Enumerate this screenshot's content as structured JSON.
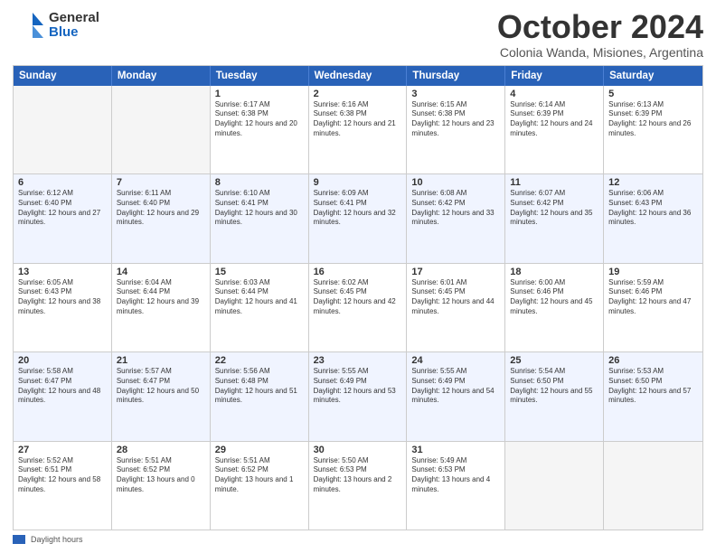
{
  "header": {
    "logo_line1": "General",
    "logo_line2": "Blue",
    "month": "October 2024",
    "location": "Colonia Wanda, Misiones, Argentina"
  },
  "days_of_week": [
    "Sunday",
    "Monday",
    "Tuesday",
    "Wednesday",
    "Thursday",
    "Friday",
    "Saturday"
  ],
  "legend": {
    "label": "Daylight hours"
  },
  "weeks": [
    [
      {
        "day": "",
        "empty": true
      },
      {
        "day": "",
        "empty": true
      },
      {
        "day": "1",
        "sunrise": "Sunrise: 6:17 AM",
        "sunset": "Sunset: 6:38 PM",
        "daylight": "Daylight: 12 hours and 20 minutes."
      },
      {
        "day": "2",
        "sunrise": "Sunrise: 6:16 AM",
        "sunset": "Sunset: 6:38 PM",
        "daylight": "Daylight: 12 hours and 21 minutes."
      },
      {
        "day": "3",
        "sunrise": "Sunrise: 6:15 AM",
        "sunset": "Sunset: 6:38 PM",
        "daylight": "Daylight: 12 hours and 23 minutes."
      },
      {
        "day": "4",
        "sunrise": "Sunrise: 6:14 AM",
        "sunset": "Sunset: 6:39 PM",
        "daylight": "Daylight: 12 hours and 24 minutes."
      },
      {
        "day": "5",
        "sunrise": "Sunrise: 6:13 AM",
        "sunset": "Sunset: 6:39 PM",
        "daylight": "Daylight: 12 hours and 26 minutes."
      }
    ],
    [
      {
        "day": "6",
        "sunrise": "Sunrise: 6:12 AM",
        "sunset": "Sunset: 6:40 PM",
        "daylight": "Daylight: 12 hours and 27 minutes."
      },
      {
        "day": "7",
        "sunrise": "Sunrise: 6:11 AM",
        "sunset": "Sunset: 6:40 PM",
        "daylight": "Daylight: 12 hours and 29 minutes."
      },
      {
        "day": "8",
        "sunrise": "Sunrise: 6:10 AM",
        "sunset": "Sunset: 6:41 PM",
        "daylight": "Daylight: 12 hours and 30 minutes."
      },
      {
        "day": "9",
        "sunrise": "Sunrise: 6:09 AM",
        "sunset": "Sunset: 6:41 PM",
        "daylight": "Daylight: 12 hours and 32 minutes."
      },
      {
        "day": "10",
        "sunrise": "Sunrise: 6:08 AM",
        "sunset": "Sunset: 6:42 PM",
        "daylight": "Daylight: 12 hours and 33 minutes."
      },
      {
        "day": "11",
        "sunrise": "Sunrise: 6:07 AM",
        "sunset": "Sunset: 6:42 PM",
        "daylight": "Daylight: 12 hours and 35 minutes."
      },
      {
        "day": "12",
        "sunrise": "Sunrise: 6:06 AM",
        "sunset": "Sunset: 6:43 PM",
        "daylight": "Daylight: 12 hours and 36 minutes."
      }
    ],
    [
      {
        "day": "13",
        "sunrise": "Sunrise: 6:05 AM",
        "sunset": "Sunset: 6:43 PM",
        "daylight": "Daylight: 12 hours and 38 minutes."
      },
      {
        "day": "14",
        "sunrise": "Sunrise: 6:04 AM",
        "sunset": "Sunset: 6:44 PM",
        "daylight": "Daylight: 12 hours and 39 minutes."
      },
      {
        "day": "15",
        "sunrise": "Sunrise: 6:03 AM",
        "sunset": "Sunset: 6:44 PM",
        "daylight": "Daylight: 12 hours and 41 minutes."
      },
      {
        "day": "16",
        "sunrise": "Sunrise: 6:02 AM",
        "sunset": "Sunset: 6:45 PM",
        "daylight": "Daylight: 12 hours and 42 minutes."
      },
      {
        "day": "17",
        "sunrise": "Sunrise: 6:01 AM",
        "sunset": "Sunset: 6:45 PM",
        "daylight": "Daylight: 12 hours and 44 minutes."
      },
      {
        "day": "18",
        "sunrise": "Sunrise: 6:00 AM",
        "sunset": "Sunset: 6:46 PM",
        "daylight": "Daylight: 12 hours and 45 minutes."
      },
      {
        "day": "19",
        "sunrise": "Sunrise: 5:59 AM",
        "sunset": "Sunset: 6:46 PM",
        "daylight": "Daylight: 12 hours and 47 minutes."
      }
    ],
    [
      {
        "day": "20",
        "sunrise": "Sunrise: 5:58 AM",
        "sunset": "Sunset: 6:47 PM",
        "daylight": "Daylight: 12 hours and 48 minutes."
      },
      {
        "day": "21",
        "sunrise": "Sunrise: 5:57 AM",
        "sunset": "Sunset: 6:47 PM",
        "daylight": "Daylight: 12 hours and 50 minutes."
      },
      {
        "day": "22",
        "sunrise": "Sunrise: 5:56 AM",
        "sunset": "Sunset: 6:48 PM",
        "daylight": "Daylight: 12 hours and 51 minutes."
      },
      {
        "day": "23",
        "sunrise": "Sunrise: 5:55 AM",
        "sunset": "Sunset: 6:49 PM",
        "daylight": "Daylight: 12 hours and 53 minutes."
      },
      {
        "day": "24",
        "sunrise": "Sunrise: 5:55 AM",
        "sunset": "Sunset: 6:49 PM",
        "daylight": "Daylight: 12 hours and 54 minutes."
      },
      {
        "day": "25",
        "sunrise": "Sunrise: 5:54 AM",
        "sunset": "Sunset: 6:50 PM",
        "daylight": "Daylight: 12 hours and 55 minutes."
      },
      {
        "day": "26",
        "sunrise": "Sunrise: 5:53 AM",
        "sunset": "Sunset: 6:50 PM",
        "daylight": "Daylight: 12 hours and 57 minutes."
      }
    ],
    [
      {
        "day": "27",
        "sunrise": "Sunrise: 5:52 AM",
        "sunset": "Sunset: 6:51 PM",
        "daylight": "Daylight: 12 hours and 58 minutes."
      },
      {
        "day": "28",
        "sunrise": "Sunrise: 5:51 AM",
        "sunset": "Sunset: 6:52 PM",
        "daylight": "Daylight: 13 hours and 0 minutes."
      },
      {
        "day": "29",
        "sunrise": "Sunrise: 5:51 AM",
        "sunset": "Sunset: 6:52 PM",
        "daylight": "Daylight: 13 hours and 1 minute."
      },
      {
        "day": "30",
        "sunrise": "Sunrise: 5:50 AM",
        "sunset": "Sunset: 6:53 PM",
        "daylight": "Daylight: 13 hours and 2 minutes."
      },
      {
        "day": "31",
        "sunrise": "Sunrise: 5:49 AM",
        "sunset": "Sunset: 6:53 PM",
        "daylight": "Daylight: 13 hours and 4 minutes."
      },
      {
        "day": "",
        "empty": true
      },
      {
        "day": "",
        "empty": true
      }
    ]
  ]
}
